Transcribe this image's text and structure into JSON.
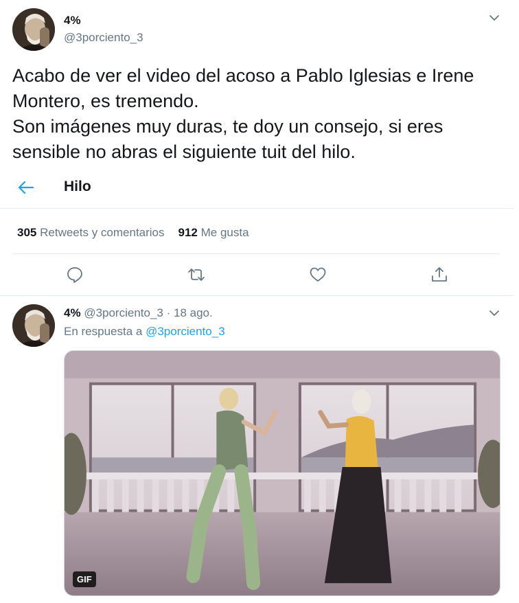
{
  "colors": {
    "accent": "#1da1f2",
    "text_primary": "#14171a",
    "text_secondary": "#657786",
    "divider": "#e6ecf0",
    "icon": "#657786"
  },
  "main_tweet": {
    "display_name": "4%",
    "handle": "@3porciento_3",
    "text": "Acabo de ver el video del acoso a Pablo Iglesias e Irene Montero, es tremendo.\nSon imágenes muy duras, te doy un consejo, si eres sensible no abras el siguiente tuit del hilo.",
    "menu_icon": "chevron-down-icon",
    "avatar_icon": "profile-avatar"
  },
  "thread_bar": {
    "back_icon": "back-arrow-icon",
    "title": "Hilo"
  },
  "stats": {
    "retweets_count": "305",
    "retweets_label": "Retweets y comentarios",
    "likes_count": "912",
    "likes_label": "Me gusta"
  },
  "actions": [
    {
      "name": "reply",
      "icon": "reply-icon"
    },
    {
      "name": "retweet",
      "icon": "retweet-icon"
    },
    {
      "name": "like",
      "icon": "heart-icon"
    },
    {
      "name": "share",
      "icon": "share-icon"
    }
  ],
  "reply_tweet": {
    "display_name": "4%",
    "handle": "@3porciento_3",
    "separator": "·",
    "date": "18 ago.",
    "reply_prefix": "En respuesta a",
    "reply_mention": "@3porciento_3",
    "menu_icon": "chevron-down-icon",
    "media": {
      "badge": "GIF"
    }
  }
}
